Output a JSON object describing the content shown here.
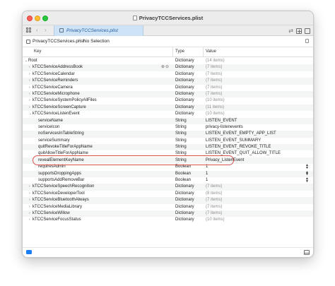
{
  "window": {
    "title": "PrivacyTCCServices.plist"
  },
  "tabbar": {
    "active_tab": "PrivacyTCCServices.plist",
    "back_glyph": "‹",
    "forward_glyph": "›",
    "split_glyph": "⇄"
  },
  "pathbar": {
    "file": "PrivacyTCCServices.plist",
    "separator": "›",
    "selection": "No Selection"
  },
  "columns": {
    "key": "Key",
    "type": "Type",
    "value": "Value"
  },
  "rows": [
    {
      "key": "Root",
      "disclosure": "⌄",
      "indent": 0,
      "type": "Dictionary",
      "value": "(14 items)",
      "dim": true
    },
    {
      "key": "kTCCServiceAddressBook",
      "disclosure": "›",
      "indent": 1,
      "type": "Dictionary",
      "value": "(7 items)",
      "dim": true,
      "actions": "⊕⊖"
    },
    {
      "key": "kTCCServiceCalendar",
      "disclosure": "›",
      "indent": 1,
      "type": "Dictionary",
      "value": "(7 items)",
      "dim": true
    },
    {
      "key": "kTCCServiceReminders",
      "disclosure": "›",
      "indent": 1,
      "type": "Dictionary",
      "value": "(7 items)",
      "dim": true
    },
    {
      "key": "kTCCServiceCamera",
      "disclosure": "›",
      "indent": 1,
      "type": "Dictionary",
      "value": "(7 items)",
      "dim": true
    },
    {
      "key": "kTCCServiceMicrophone",
      "disclosure": "›",
      "indent": 1,
      "type": "Dictionary",
      "value": "(7 items)",
      "dim": true
    },
    {
      "key": "kTCCServiceSystemPolicyAllFiles",
      "disclosure": "›",
      "indent": 1,
      "type": "Dictionary",
      "value": "(10 items)",
      "dim": true
    },
    {
      "key": "kTCCServiceScreenCapture",
      "disclosure": "›",
      "indent": 1,
      "type": "Dictionary",
      "value": "(11 items)",
      "dim": true
    },
    {
      "key": "kTCCServiceListenEvent",
      "disclosure": "⌄",
      "indent": 1,
      "type": "Dictionary",
      "value": "(10 items)",
      "dim": true
    },
    {
      "key": "serviceName",
      "disclosure": "",
      "indent": 2,
      "type": "String",
      "value": "LISTEN_EVENT"
    },
    {
      "key": "serviceIcon",
      "disclosure": "",
      "indent": 2,
      "type": "String",
      "value": "privacy-listenevents"
    },
    {
      "key": "noServicesInTableString",
      "disclosure": "",
      "indent": 2,
      "type": "String",
      "value": "LISTEN_EVENT_EMPTY_APP_LIST"
    },
    {
      "key": "serviceSummary",
      "disclosure": "",
      "indent": 2,
      "type": "String",
      "value": "LISTEN_EVENT_SUMMARY"
    },
    {
      "key": "quitRevokeTitleForAppName",
      "disclosure": "",
      "indent": 2,
      "type": "String",
      "value": "LISTEN_EVENT_REVOKE_TITLE"
    },
    {
      "key": "quitAllowTitleForAppName",
      "disclosure": "",
      "indent": 2,
      "type": "String",
      "value": "LISTEN_EVENT_QUIT_ALLOW_TITLE"
    },
    {
      "key": "revealElementKeyName",
      "disclosure": "",
      "indent": 2,
      "type": "String",
      "value": "Privacy_ListenEvent"
    },
    {
      "key": "requiresAdmin",
      "disclosure": "",
      "indent": 2,
      "type": "Boolean",
      "value": "1",
      "stepper": true
    },
    {
      "key": "supportsDroppingApps",
      "disclosure": "",
      "indent": 2,
      "type": "Boolean",
      "value": "1",
      "stepper": true
    },
    {
      "key": "supportsAddRemoveBar",
      "disclosure": "",
      "indent": 2,
      "type": "Boolean",
      "value": "1",
      "stepper": true
    },
    {
      "key": "kTCCServiceSpeechRecognition",
      "disclosure": "›",
      "indent": 1,
      "type": "Dictionary",
      "value": "(7 items)",
      "dim": true
    },
    {
      "key": "kTCCServiceDeveloperTool",
      "disclosure": "›",
      "indent": 1,
      "type": "Dictionary",
      "value": "(8 items)",
      "dim": true
    },
    {
      "key": "kTCCServiceBluetoothAlways",
      "disclosure": "›",
      "indent": 1,
      "type": "Dictionary",
      "value": "(7 items)",
      "dim": true
    },
    {
      "key": "kTCCServiceMediaLibrary",
      "disclosure": "›",
      "indent": 1,
      "type": "Dictionary",
      "value": "(7 items)",
      "dim": true
    },
    {
      "key": "kTCCServiceWillow",
      "disclosure": "›",
      "indent": 1,
      "type": "Dictionary",
      "value": "(7 items)",
      "dim": true
    },
    {
      "key": "kTCCServiceFocusStatus",
      "disclosure": "›",
      "indent": 1,
      "type": "Dictionary",
      "value": "(10 items)",
      "dim": true
    }
  ],
  "highlight_color": "#d9534f",
  "accent_color": "#1a7ef5"
}
